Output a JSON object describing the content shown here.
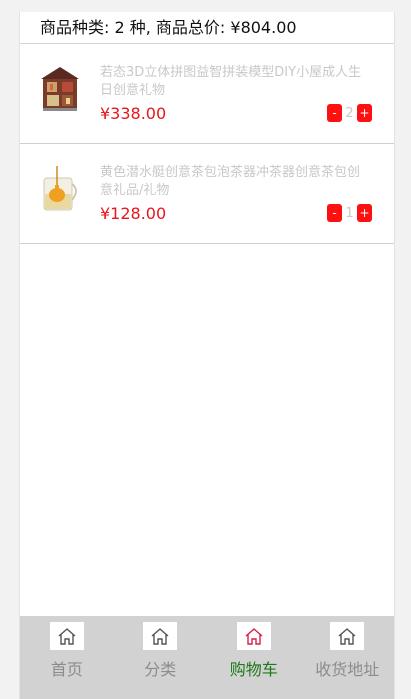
{
  "summary": {
    "text": "商品种类: 2 种, 商品总价: ¥804.00"
  },
  "cart_items": [
    {
      "title": "若态3D立体拼图益智拼装模型DIY小屋成人生日创意礼物",
      "price": "¥338.00",
      "quantity": "2",
      "minus_label": "-",
      "plus_label": "+"
    },
    {
      "title": "黄色潜水艇创意茶包泡茶器冲茶器创意茶包创意礼品/礼物",
      "price": "¥128.00",
      "quantity": "1",
      "minus_label": "-",
      "plus_label": "+"
    }
  ],
  "tabs": [
    {
      "label": "首页",
      "icon": "home-icon",
      "active": false
    },
    {
      "label": "分类",
      "icon": "home-icon",
      "active": false
    },
    {
      "label": "购物车",
      "icon": "home-icon",
      "active": true
    },
    {
      "label": "收货地址",
      "icon": "home-icon",
      "active": false
    }
  ],
  "colors": {
    "price": "#e8161b",
    "qty_button": "#ff1010",
    "active_tab_label": "#1c7a1c",
    "active_tab_icon": "#d6204a",
    "inactive_tab_icon": "#555555",
    "tabbar_bg": "#d2d2d2"
  }
}
